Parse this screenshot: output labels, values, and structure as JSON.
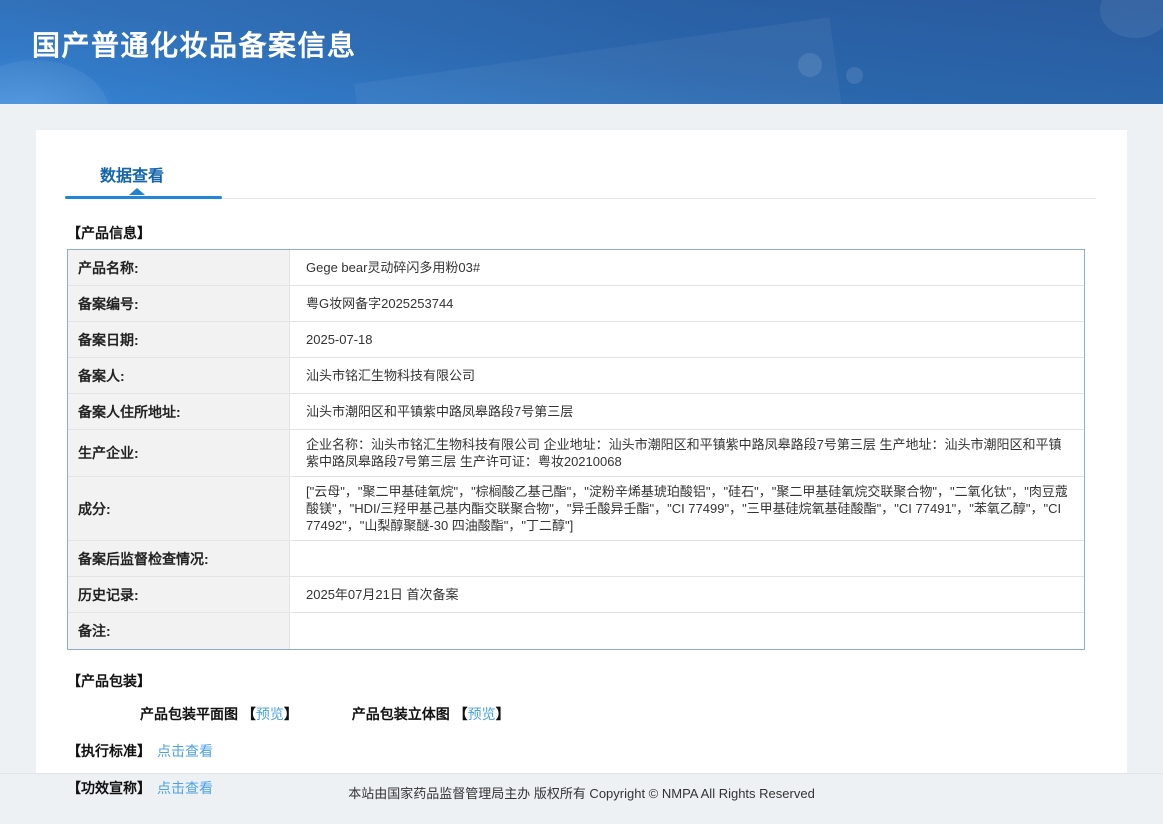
{
  "banner": {
    "title": "国产普通化妆品备案信息"
  },
  "tabs": {
    "data_view": "数据查看"
  },
  "product_info": {
    "section_title": "【产品信息】",
    "rows": [
      {
        "label": "产品名称:",
        "value": "Gege bear灵动碎闪多用粉03#"
      },
      {
        "label": "备案编号:",
        "value": "粤G妆网备字2025253744"
      },
      {
        "label": "备案日期:",
        "value": "2025-07-18"
      },
      {
        "label": "备案人:",
        "value": "汕头市铭汇生物科技有限公司"
      },
      {
        "label": "备案人住所地址:",
        "value": "汕头市潮阳区和平镇紫中路凤皋路段7号第三层"
      },
      {
        "label": "生产企业:",
        "value": "企业名称：汕头市铭汇生物科技有限公司 企业地址：汕头市潮阳区和平镇紫中路凤皋路段7号第三层 生产地址：汕头市潮阳区和平镇紫中路凤皋路段7号第三层 生产许可证：粤妆20210068"
      },
      {
        "label": "成分:",
        "value": "[\"云母\"，\"聚二甲基硅氧烷\"，\"棕榈酸乙基己酯\"，\"淀粉辛烯基琥珀酸铝\"，\"硅石\"，\"聚二甲基硅氧烷交联聚合物\"，\"二氧化钛\"，\"肉豆蔻酸镁\"，\"HDI/三羟甲基己基内酯交联聚合物\"，\"异壬酸异壬酯\"，\"CI 77499\"，\"三甲基硅烷氧基硅酸酯\"，\"CI 77491\"，\"苯氧乙醇\"，\"CI 77492\"，\"山梨醇聚醚-30 四油酸酯\"，\"丁二醇\"]"
      },
      {
        "label": "备案后监督检查情况:",
        "value": ""
      },
      {
        "label": "历史记录:",
        "value": "2025年07月21日 首次备案"
      },
      {
        "label": "备注:",
        "value": ""
      }
    ]
  },
  "packaging": {
    "section_title": "【产品包装】",
    "bracket_open": "【",
    "bracket_close": "】",
    "items": [
      {
        "label": "产品包装平面图 ",
        "link": "预览"
      },
      {
        "label": "产品包装立体图  ",
        "link": "预览"
      }
    ]
  },
  "standard": {
    "label": "【执行标准】",
    "link": "点击查看"
  },
  "efficacy": {
    "label": "【功效宣称】",
    "link": "点击查看"
  },
  "footer": {
    "text": "本站由国家药品监督管理局主办 版权所有 Copyright © NMPA All Rights Reserved"
  }
}
